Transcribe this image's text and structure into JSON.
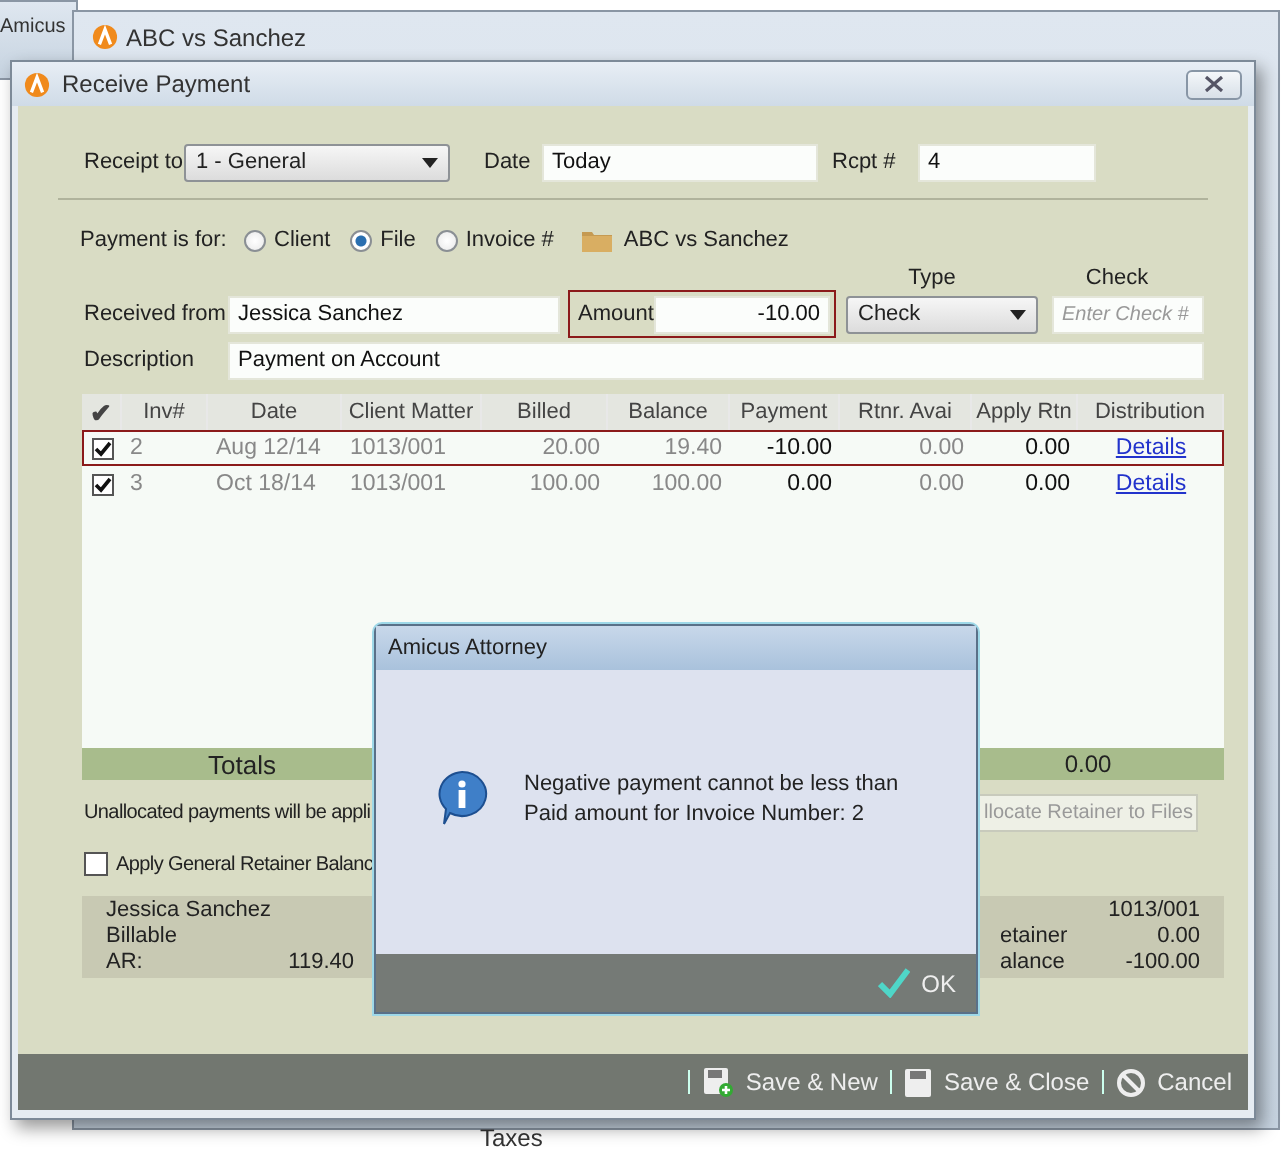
{
  "background_windows": [
    {
      "title": "Amicus"
    },
    {
      "title": "ABC vs Sanchez"
    }
  ],
  "background_text": "Taxes",
  "window": {
    "title": "Receive Payment"
  },
  "receipt_to": {
    "label": "Receipt to",
    "value": "1 - General"
  },
  "date": {
    "label": "Date",
    "value": "Today"
  },
  "rcpt": {
    "label": "Rcpt #",
    "value": "4"
  },
  "payment_for": {
    "label": "Payment is for:",
    "options": [
      {
        "label": "Client",
        "selected": false
      },
      {
        "label": "File",
        "selected": true
      },
      {
        "label": "Invoice #",
        "selected": false
      }
    ],
    "file_name": "ABC vs Sanchez"
  },
  "received_from": {
    "label": "Received from",
    "value": "Jessica Sanchez"
  },
  "amount": {
    "label": "Amount",
    "value": "-10.00",
    "highlighted": true
  },
  "type": {
    "label": "Type",
    "value": "Check"
  },
  "check": {
    "label": "Check",
    "placeholder": "Enter Check #"
  },
  "description": {
    "label": "Description",
    "value": "Payment on Account"
  },
  "table": {
    "header_check": "✔",
    "columns": [
      "Inv#",
      "Date",
      "Client Matter",
      "Billed",
      "Balance",
      "Payment",
      "Rtnr. Avai",
      "Apply Rtn",
      "Distribution"
    ],
    "rows": [
      {
        "checked": true,
        "selected": true,
        "cells": [
          "2",
          "Aug 12/14",
          "1013/001",
          "20.00",
          "19.40",
          "-10.00",
          "0.00",
          "0.00",
          "Details"
        ]
      },
      {
        "checked": true,
        "selected": false,
        "cells": [
          "3",
          "Oct 18/14",
          "1013/001",
          "100.00",
          "100.00",
          "0.00",
          "0.00",
          "0.00",
          "Details"
        ]
      }
    ]
  },
  "totals": {
    "label": "Totals",
    "value": "0.00"
  },
  "unallocated_note": "Unallocated payments will be appli",
  "allocate_button": "llocate Retainer to Files",
  "apply_general": {
    "label": "Apply General Retainer Balanc",
    "checked": false
  },
  "summary": {
    "name": "Jessica Sanchez",
    "billing": "Billable",
    "ar_label": "AR:",
    "ar_value": "119.40",
    "matter": "1013/001",
    "retainer_label": "etainer",
    "retainer_value": "0.00",
    "balance_label": "alance",
    "balance_value": "-100.00"
  },
  "footer_buttons": [
    {
      "kind": "save-new",
      "label": "Save & New"
    },
    {
      "kind": "save-close",
      "label": "Save & Close"
    },
    {
      "kind": "cancel",
      "label": "Cancel"
    }
  ],
  "dialog": {
    "title": "Amicus Attorney",
    "message": "Negative payment cannot be less than Paid amount for Invoice Number: 2",
    "ok": "OK"
  }
}
